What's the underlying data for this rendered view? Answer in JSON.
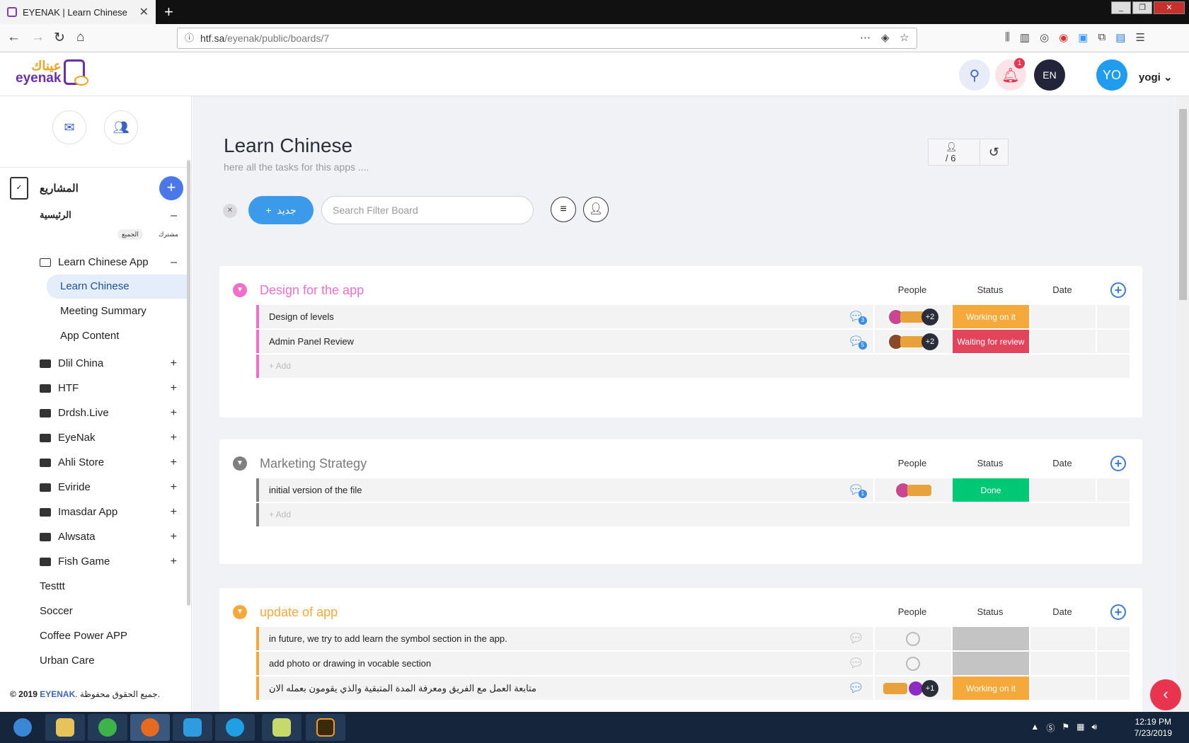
{
  "browser": {
    "tab_title": "EYENAK | Learn Chinese",
    "url_host": "htf.sa",
    "url_path": "/eyenak/public/boards/7"
  },
  "header": {
    "logo_ar": "عيناك",
    "logo_en": "eyenak",
    "notif_count": "1",
    "lang": "EN",
    "avatar_initials": "YO",
    "username": "yogi"
  },
  "sidebar": {
    "projects_title": "المشاريع",
    "home_label": "الرئيسية",
    "filter_all": "الجميع",
    "filter_shared": "مشترك",
    "open_folder": "Learn Chinese App",
    "sub_items": [
      "Learn Chinese",
      "Meeting Summary",
      "App Content"
    ],
    "folders": [
      "Dlil China",
      "HTF",
      "Drdsh.Live",
      "EyeNak",
      "Ahli Store",
      "Eviride",
      "Imasdar App",
      "Alwsata",
      "Fish Game"
    ],
    "loose_items": [
      "Testtt",
      "Soccer",
      "Coffee Power APP",
      "Urban Care"
    ],
    "copyright_prefix": "© 2019",
    "copyright_brand": "EYENAK",
    "copyright_suffix": ". جميع الحقوق محفوظة."
  },
  "board": {
    "title": "Learn Chinese",
    "subtitle": "here all the tasks for this apps ....",
    "members": "/ 6",
    "new_button": "جديد",
    "search_placeholder": "Search Filter Board",
    "col_people": "People",
    "col_status": "Status",
    "col_date": "Date",
    "add_label": "+ Add"
  },
  "groups": [
    {
      "title": "Design for the app",
      "color": "#f06fc8",
      "rows": [
        {
          "name": "Design of levels",
          "comments": "3",
          "people_more": "+2",
          "status": "Working on it",
          "status_color": "#f6a93b"
        },
        {
          "name": "Admin Panel Review",
          "comments": "5",
          "people_more": "+2",
          "status": "Waiting for review",
          "status_color": "#e2445c"
        }
      ]
    },
    {
      "title": "Marketing Strategy",
      "color": "#808080",
      "rows": [
        {
          "name": "initial version of the file",
          "comments": "1",
          "people_more": "",
          "status": "Done",
          "status_color": "#00c875"
        }
      ]
    },
    {
      "title": "update of app",
      "color": "#f6a93b",
      "rows": [
        {
          "name": "in future, we try to add learn the symbol section in the app.",
          "comments": "",
          "people_more": "",
          "status": "",
          "status_color": "#c4c4c4"
        },
        {
          "name": "add photo or drawing in vocable section",
          "comments": "",
          "people_more": "",
          "status": "",
          "status_color": "#c4c4c4"
        },
        {
          "name": "متابعة العمل مع الفريق ومعرفة المدة المتبقية والذي يقومون بعمله الان",
          "comments": "",
          "people_more": "+1",
          "status": "Working on it",
          "status_color": "#f6a93b"
        }
      ]
    }
  ],
  "taskbar": {
    "time": "12:19 PM",
    "date": "7/23/2019"
  }
}
